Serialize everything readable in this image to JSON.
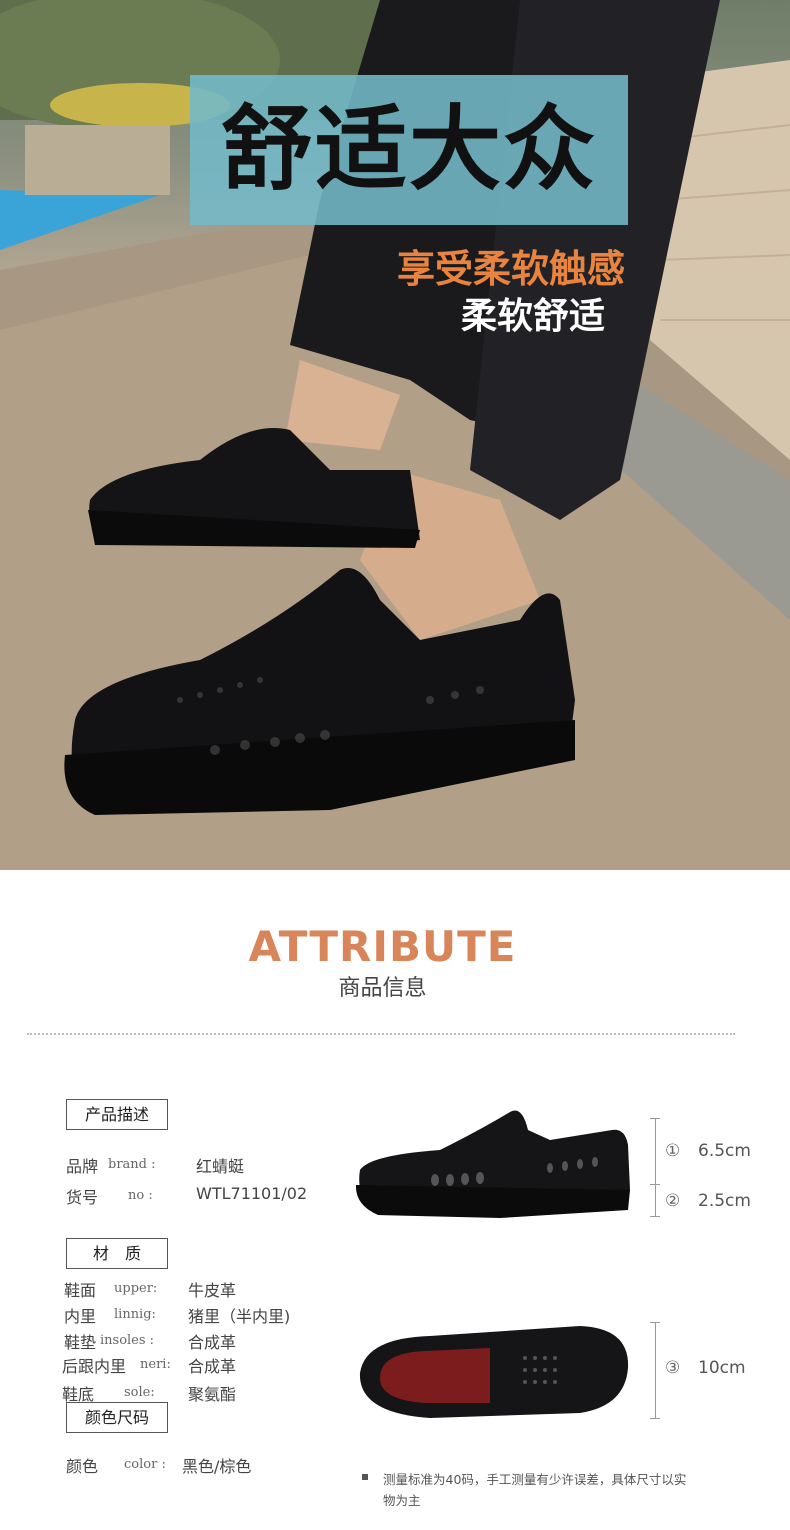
{
  "hero": {
    "title": "舒适大众",
    "sub1": "享受柔软触感",
    "sub2": "柔软舒适"
  },
  "attribute": {
    "title": "ATTRIBUTE",
    "subtitle": "商品信息"
  },
  "desc": {
    "heading": "产品描述",
    "rows": [
      {
        "cn": "品牌",
        "en": "brand :",
        "value": "红蜻蜓"
      },
      {
        "cn": "货号",
        "en": "no :",
        "value": "WTL71101/02"
      }
    ]
  },
  "material": {
    "heading": "材　质",
    "rows": [
      {
        "cn": "鞋面",
        "en": "upper:",
        "value": "牛皮革"
      },
      {
        "cn": "内里",
        "en": "linnig:",
        "value": "猪里（半内里)"
      },
      {
        "cn": "鞋垫",
        "en": "insoles :",
        "value": "合成革"
      },
      {
        "cn": "后跟内里",
        "en": "neri:",
        "value": "合成革"
      },
      {
        "cn": "鞋底",
        "en": "sole:",
        "value": "聚氨酯"
      }
    ]
  },
  "color": {
    "heading": "颜色尺码",
    "cn": "颜色",
    "en": "color :",
    "value": "黑色/棕色"
  },
  "measures": [
    {
      "num": "①",
      "value": "6.5cm"
    },
    {
      "num": "②",
      "value": "2.5cm"
    },
    {
      "num": "③",
      "value": "10cm"
    }
  ],
  "note": "测量标准为40码，手工测量有少许误差，具体尺寸以实物为主"
}
